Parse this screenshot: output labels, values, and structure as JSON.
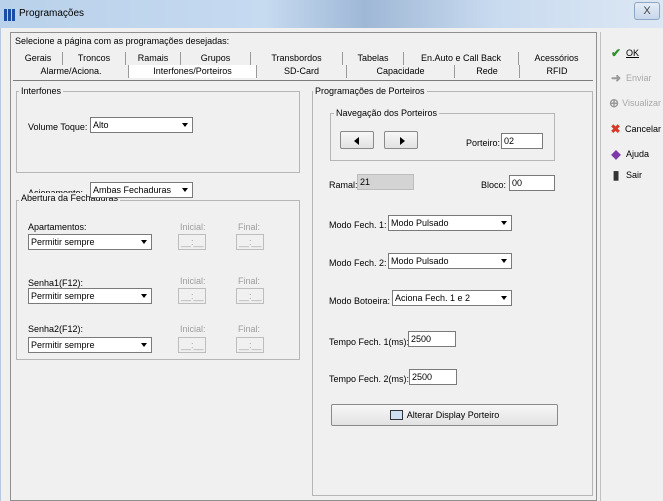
{
  "window": {
    "title": "Programações",
    "close_glyph": "X"
  },
  "prompt": "Selecione a página com as programações desejadas:",
  "tabs_row1": [
    "Gerais",
    "Troncos",
    "Ramais",
    "Grupos",
    "Transbordos",
    "Tabelas",
    "En.Auto e Call Back",
    "Acessórios"
  ],
  "tabs_row2": [
    "Alarme/Aciona.",
    "Interfones/Porteiros",
    "SD-Card",
    "Capacidade",
    "Rede",
    "RFID"
  ],
  "active_tab": "Interfones/Porteiros",
  "interfones": {
    "title": "Interfones",
    "volume_label": "Volume Toque:",
    "volume_value": "Alto",
    "acionamento_label": "Acionamento:",
    "acionamento_value": "Ambas Fechaduras"
  },
  "abertura": {
    "title": "Abertura da Fechaduras",
    "inicial_label": "Inicial:",
    "final_label": "Final:",
    "time_placeholder": "__:__",
    "rows": [
      {
        "label": "Apartamentos:",
        "value": "Permitir sempre"
      },
      {
        "label": "Senha1(F12):",
        "value": "Permitir sempre"
      },
      {
        "label": "Senha2(F12):",
        "value": "Permitir sempre"
      }
    ]
  },
  "porteiros": {
    "title": "Programações de Porteiros",
    "nav_title": "Navegação dos Porteiros",
    "porteiro_label": "Porteiro:",
    "porteiro_value": "02",
    "ramal_label": "Ramal:",
    "ramal_value": "21",
    "bloco_label": "Bloco:",
    "bloco_value": "00",
    "fech1_label": "Modo Fech. 1:",
    "fech1_value": "Modo Pulsado",
    "fech2_label": "Modo Fech. 2:",
    "fech2_value": "Modo Pulsado",
    "botoeira_label": "Modo Botoeira:",
    "botoeira_value": "Aciona Fech. 1 e 2",
    "tempo1_label": "Tempo Fech. 1(ms):",
    "tempo1_value": "2500",
    "tempo2_label": "Tempo Fech. 2(ms):",
    "tempo2_value": "2500",
    "display_button": "Alterar Display Porteiro"
  },
  "side_buttons": [
    {
      "label": "OK",
      "icon": "check-icon",
      "color": "#2f8f2f",
      "enabled": true
    },
    {
      "label": "Enviar",
      "icon": "send-icon",
      "color": "#9a9a9a",
      "enabled": false
    },
    {
      "label": "Visualizar",
      "icon": "magnifier-icon",
      "color": "#9a9a9a",
      "enabled": false
    },
    {
      "label": "Cancelar",
      "icon": "x-icon",
      "color": "#d43a2a",
      "enabled": true
    },
    {
      "label": "Ajuda",
      "icon": "help-book-icon",
      "color": "#7b3aa8",
      "enabled": true
    },
    {
      "label": "Sair",
      "icon": "exit-door-icon",
      "color": "#333333",
      "enabled": true
    }
  ]
}
